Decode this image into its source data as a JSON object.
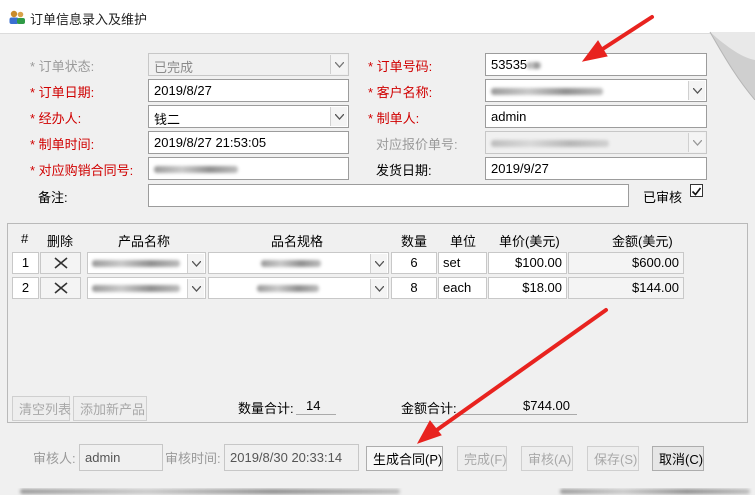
{
  "window": {
    "title": "订单信息录入及维护"
  },
  "form": {
    "order_status": {
      "label": "* 订单状态:",
      "value": "已完成"
    },
    "order_no": {
      "label": "* 订单号码:",
      "value": "53535"
    },
    "order_date": {
      "label": "* 订单日期:",
      "value": "2019/8/27"
    },
    "customer": {
      "label": "* 客户名称:"
    },
    "handler": {
      "label": "* 经办人:",
      "value": "钱二"
    },
    "maker": {
      "label": "* 制单人:",
      "value": "admin"
    },
    "make_time": {
      "label": "* 制单时间:",
      "value": "2019/8/27 21:53:05"
    },
    "quote_no": {
      "label": "对应报价单号:"
    },
    "purchase_contract": {
      "label": "* 对应购销合同号:"
    },
    "ship_date": {
      "label": "发货日期:",
      "value": "2019/9/27"
    },
    "remark": {
      "label": "备注:",
      "value": ""
    },
    "reviewed": {
      "label": "已审核",
      "checked": true
    }
  },
  "table": {
    "headers": [
      "#",
      "删除",
      "产品名称",
      "品名规格",
      "数量",
      "单位",
      "单价(美元)",
      "金额(美元)"
    ],
    "rows": [
      {
        "num": "1",
        "qty": "6",
        "unit": "set",
        "price": "$100.00",
        "amount": "$600.00"
      },
      {
        "num": "2",
        "qty": "8",
        "unit": "each",
        "price": "$18.00",
        "amount": "$144.00"
      }
    ],
    "clear_label": "清空列表",
    "add_label": "添加新产品",
    "qty_total_label": "数量合计:",
    "qty_total": "14",
    "amount_total_label": "金额合计:",
    "amount_total": "$744.00"
  },
  "footer": {
    "reviewer_label": "审核人:",
    "reviewer": "admin",
    "review_time_label": "审核时间:",
    "review_time": "2019/8/30 20:33:14",
    "buttons": {
      "generate": "生成合同(P)",
      "complete": "完成(F)",
      "review": "审核(A)",
      "save": "保存(S)",
      "cancel": "取消(C)"
    }
  },
  "colors": {
    "required": "#d00000",
    "annotation_arrow": "#e8231f"
  }
}
